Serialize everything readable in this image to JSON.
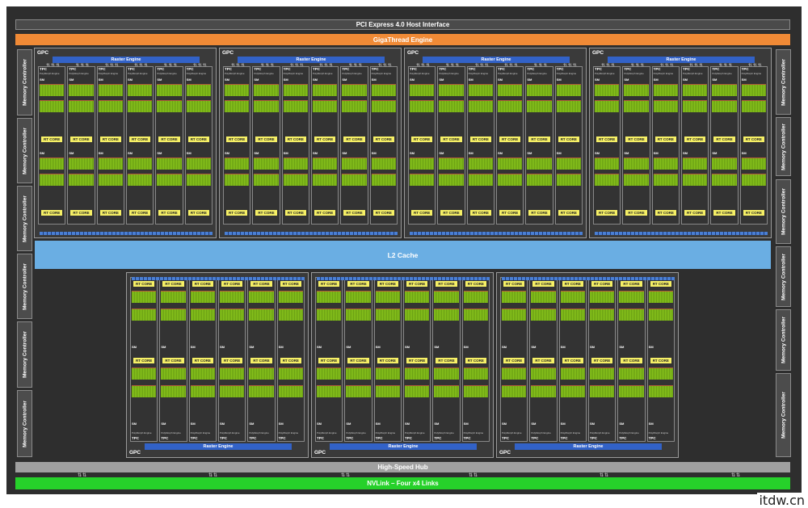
{
  "title_bar": "PCI Express 4.0 Host Interface",
  "gigathread": "GigaThread Engine",
  "l2_cache": "L2 Cache",
  "hub": "High-Speed Hub",
  "nvlink": "NVLink – Four x4 Links",
  "gpc_label": "GPC",
  "raster_engine": "Raster Engine",
  "tpc_label": "TPC",
  "polymorph_label": "PolyMorph Engine",
  "sm_label": "SM",
  "rt_core_label": "RT CORE",
  "memory_controller": "Memory Controller",
  "watermark": "itdw.cn",
  "colors": {
    "gigathread": "#f08a36",
    "l2_cache": "#6aaee3",
    "nvlink": "#26d12a",
    "raster_engine": "#3262c8",
    "rt_core": "#f6f066",
    "cuda_core": "#88c41c"
  }
}
